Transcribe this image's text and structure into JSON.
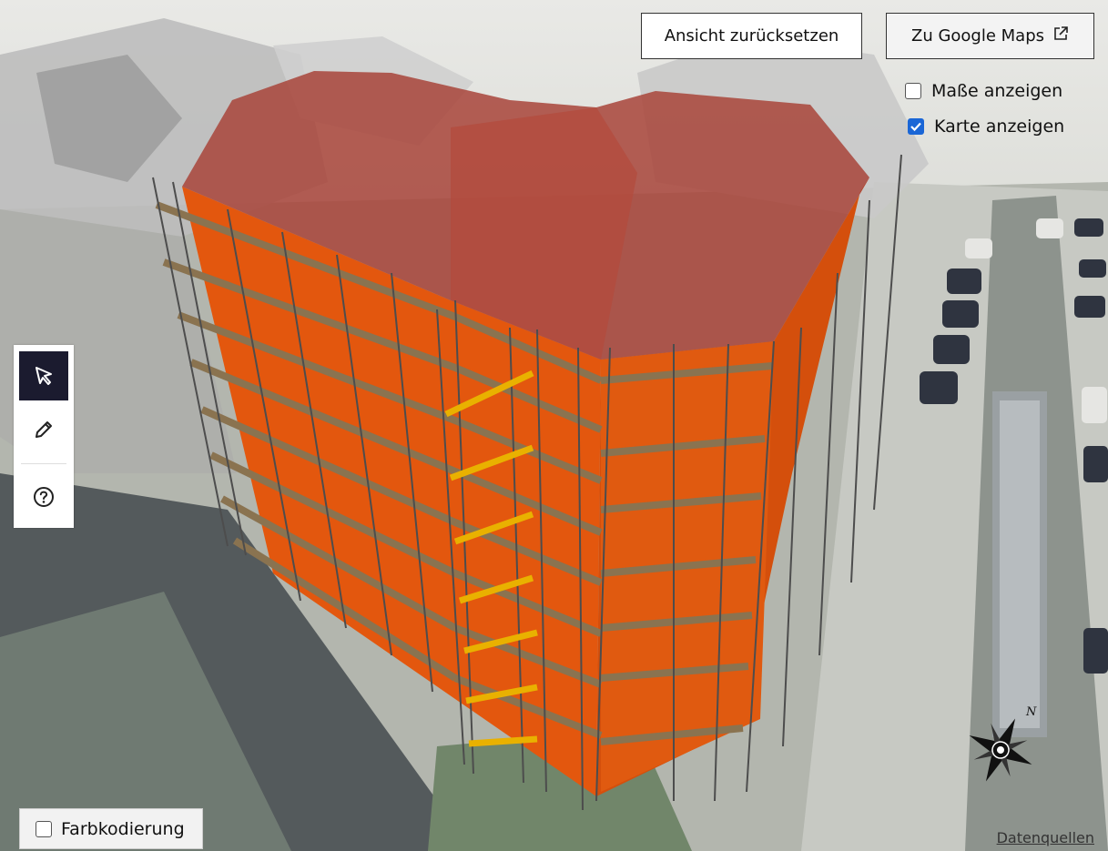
{
  "controls": {
    "reset_view_label": "Ansicht zurücksetzen",
    "google_maps_label": "Zu Google Maps",
    "show_dimensions_label": "Maße anzeigen",
    "show_dimensions_checked": false,
    "show_map_label": "Karte anzeigen",
    "show_map_checked": true,
    "color_coding_label": "Farbkodierung",
    "color_coding_checked": false,
    "data_sources_label": "Datenquellen"
  },
  "toolbar": {
    "tools": [
      {
        "name": "select",
        "icon": "cursor-arrow-icon",
        "active": true
      },
      {
        "name": "draw",
        "icon": "pencil-icon",
        "active": false
      },
      {
        "name": "help",
        "icon": "question-circle-icon",
        "active": false
      }
    ]
  },
  "compass": {
    "north_label": "N"
  },
  "colors": {
    "building_orange": "#e3570e",
    "roof_red": "#a8443a",
    "scaffold_deck": "#8a7350",
    "stairs_yellow": "#e9b100",
    "checkbox_blue": "#1a66d6",
    "active_tool_bg": "#1b1b2f"
  }
}
